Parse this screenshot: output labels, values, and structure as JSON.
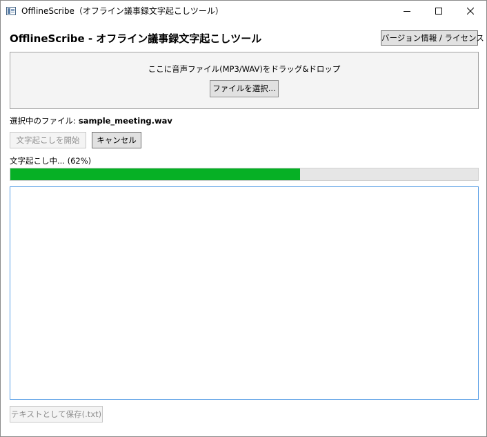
{
  "window": {
    "title": "OfflineScribe（オフライン議事録文字起こしツール）",
    "icon": "app-document-icon"
  },
  "header": {
    "heading": "OfflineScribe - オフライン議事録文字起こしツール",
    "about_label": "バージョン情報 / ライセンス"
  },
  "dropzone": {
    "prompt": "ここに音声ファイル(MP3/WAV)をドラッグ&ドロップ",
    "select_label": "ファイルを選択..."
  },
  "file": {
    "label": "選択中のファイル:",
    "name": "sample_meeting.wav"
  },
  "actions": {
    "start_label": "文字起こしを開始",
    "start_enabled": false,
    "cancel_label": "キャンセル"
  },
  "progress": {
    "status": "文字起こし中... (62%)",
    "percent": 62,
    "fill_color": "#06b025",
    "track_color": "#e6e6e6"
  },
  "transcript": {
    "value": ""
  },
  "footer": {
    "save_label": "テキストとして保存(.txt)",
    "save_enabled": false
  },
  "colors": {
    "focus_border": "#569de5",
    "disabled_text": "#8e8e8e"
  }
}
